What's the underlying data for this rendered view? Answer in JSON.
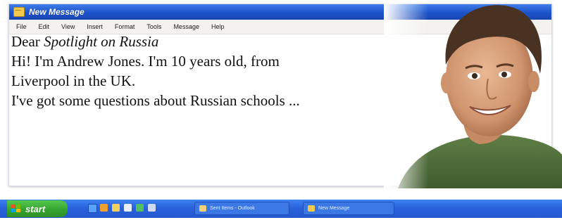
{
  "window": {
    "title": "New Message"
  },
  "menu": [
    "File",
    "Edit",
    "View",
    "Insert",
    "Format",
    "Tools",
    "Message",
    "Help"
  ],
  "message": {
    "greeting_prefix": "Dear",
    "greeting_name": "Spotlight on Russia",
    "line1": "Hi! I'm Andrew Jones. I'm 10 years old, from",
    "line2": "Liverpool in the UK.",
    "line3": "I've got some questions about Russian schools ..."
  },
  "taskbar": {
    "start_label": "start",
    "quick_launch": [
      "ie-icon",
      "media-icon",
      "folder-icon",
      "mail-icon",
      "messenger-icon",
      "desktop-icon"
    ],
    "buttons": [
      {
        "label": "Sent Items - Outlook",
        "icon": "outlook-icon"
      },
      {
        "label": "New Message",
        "icon": "new-message-icon"
      }
    ]
  },
  "colors": {
    "titlebar": "#1c53c9",
    "taskbar": "#2a62db",
    "start_button": "#34a22e"
  }
}
